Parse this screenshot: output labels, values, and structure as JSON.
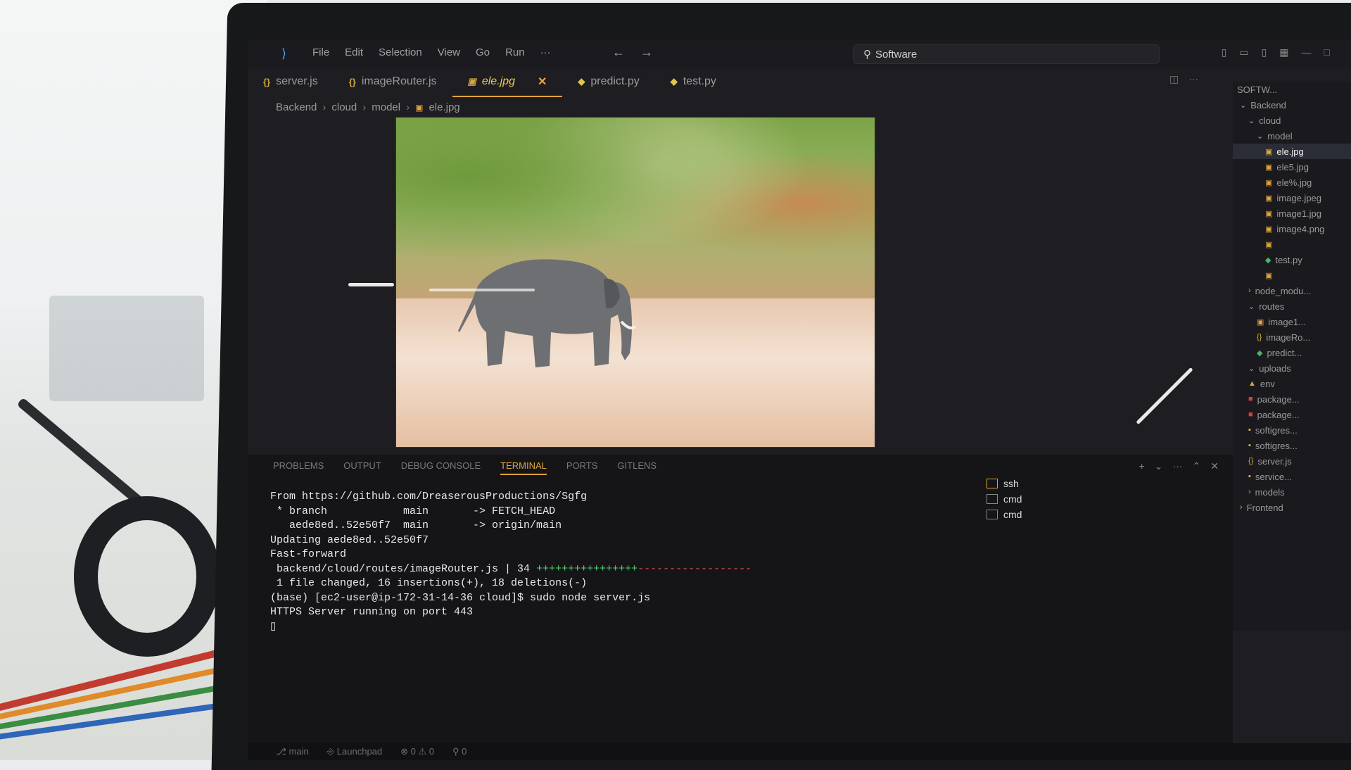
{
  "window": {
    "search": "Software",
    "menu": [
      "File",
      "Edit",
      "Selection",
      "View",
      "Go",
      "Run",
      "···"
    ]
  },
  "tabs": [
    {
      "icon": "{}",
      "label": "server.js"
    },
    {
      "icon": "{}",
      "label": "imageRouter.js"
    },
    {
      "icon": "img",
      "label": "ele.jpg",
      "active": true
    },
    {
      "icon": "py",
      "label": "predict.py"
    },
    {
      "icon": "py",
      "label": "test.py"
    }
  ],
  "breadcrumb": [
    "Backend",
    "cloud",
    "model",
    "ele.jpg"
  ],
  "explorer": {
    "header": "SOFTW...",
    "items": [
      {
        "label": "Backend",
        "indent": 0,
        "icon": "chevron-down"
      },
      {
        "label": "cloud",
        "indent": 1,
        "icon": "chevron-down"
      },
      {
        "label": "model",
        "indent": 2,
        "icon": "chevron-down"
      },
      {
        "label": "ele.jpg",
        "indent": 3,
        "icon": "image",
        "selected": true
      },
      {
        "label": "ele5.jpg",
        "indent": 3,
        "icon": "image"
      },
      {
        "label": "ele%.jpg",
        "indent": 3,
        "icon": "image"
      },
      {
        "label": "image.jpeg",
        "indent": 3,
        "icon": "image"
      },
      {
        "label": "image1.jpg",
        "indent": 3,
        "icon": "image"
      },
      {
        "label": "image4.png",
        "indent": 3,
        "icon": "image"
      },
      {
        "label": "",
        "indent": 3,
        "icon": "image"
      },
      {
        "label": "test.py",
        "indent": 3,
        "icon": "python"
      },
      {
        "label": "",
        "indent": 3,
        "icon": "image"
      },
      {
        "label": "node_modu...",
        "indent": 1,
        "icon": "chevron-right"
      },
      {
        "label": "routes",
        "indent": 1,
        "icon": "chevron-down"
      },
      {
        "label": "image1...",
        "indent": 2,
        "icon": "image"
      },
      {
        "label": "imageRo...",
        "indent": 2,
        "icon": "js"
      },
      {
        "label": "predict...",
        "indent": 2,
        "icon": "python"
      },
      {
        "label": "uploads",
        "indent": 1,
        "icon": "chevron-down"
      },
      {
        "label": "env",
        "indent": 1,
        "icon": "lock"
      },
      {
        "label": "package...",
        "indent": 1,
        "icon": "npm"
      },
      {
        "label": "package...",
        "indent": 1,
        "icon": "npm"
      },
      {
        "label": "softigres...",
        "indent": 1,
        "icon": "file"
      },
      {
        "label": "softigres...",
        "indent": 1,
        "icon": "file"
      },
      {
        "label": "server.js",
        "indent": 1,
        "icon": "js"
      },
      {
        "label": "service...",
        "indent": 1,
        "icon": "file"
      },
      {
        "label": "models",
        "indent": 1,
        "icon": "chevron-right"
      },
      {
        "label": "Frontend",
        "indent": 0,
        "icon": "chevron-right"
      }
    ]
  },
  "panel": {
    "tabs": [
      "PROBLEMS",
      "OUTPUT",
      "DEBUG CONSOLE",
      "TERMINAL",
      "PORTS",
      "GITLENS"
    ],
    "active_tab": "TERMINAL",
    "terminal_lines": [
      "From https://github.com/DreaserousProductions/Sgfg",
      " * branch            main       -> FETCH_HEAD",
      "   aede8ed..52e50f7  main       -> origin/main",
      "Updating aede8ed..52e50f7",
      "Fast-forward",
      " backend/cloud/routes/imageRouter.js | 34 ",
      " 1 file changed, 16 insertions(+), 18 deletions(-)",
      "(base) [ec2-user@ip-172-31-14-36 cloud]$ sudo node server.js",
      "HTTPS Server running on port 443",
      "▯"
    ],
    "diff_plus": "++++++++++++++++",
    "diff_minus": "------------------",
    "terminals": [
      "ssh",
      "cmd",
      "cmd"
    ]
  },
  "statusbar": [
    "main",
    "Launchpad",
    "⊗ 0 ⚠ 0",
    "⚲ 0"
  ]
}
